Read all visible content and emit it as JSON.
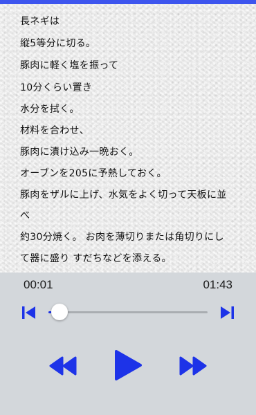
{
  "recipe": {
    "lines": [
      "長ネギは",
      "縦5等分に切る。",
      "豚肉に軽く塩を振って",
      "10分くらい置き",
      "水分を拭く。",
      "材料を合わせ、",
      "豚肉に漬け込み一晩おく。",
      "オーブンを205に予熱しておく。",
      "豚肉をザルに上げ、水気をよく切って天板に並",
      "べ",
      "約30分焼く。 お肉を薄切りまたは角切りにし",
      "て器に盛り すだちなどを添える。"
    ]
  },
  "player": {
    "elapsed": "00:01",
    "duration": "01:43",
    "progress": 0.07
  },
  "icons": {
    "skip_back": "skip-back-icon",
    "skip_forward": "skip-forward-icon",
    "rewind": "rewind-icon",
    "play": "play-icon",
    "fast_forward": "fast-forward-icon"
  },
  "colors": {
    "accent": "#1d33e8",
    "header": "#3d55ee",
    "player_bg": "#d3d7db"
  }
}
